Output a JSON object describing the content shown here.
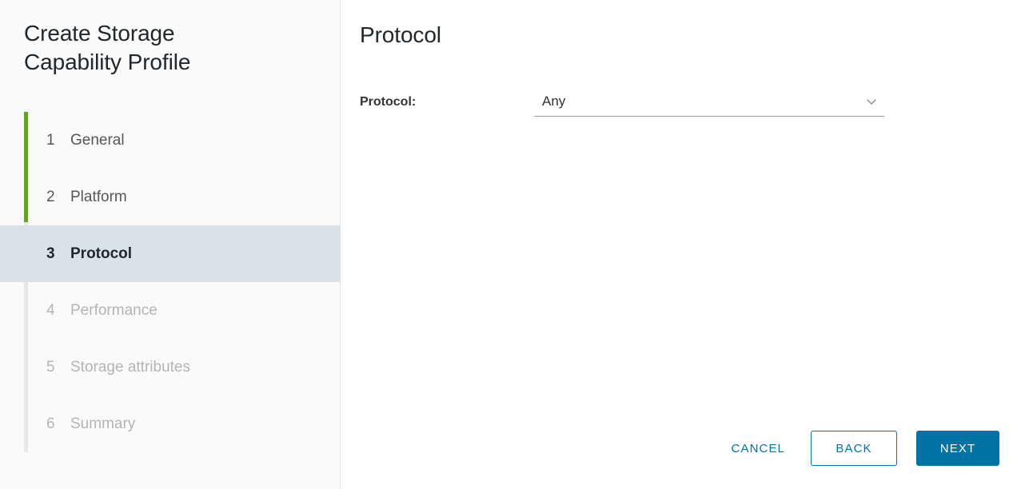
{
  "wizard": {
    "title": "Create Storage\nCapability Profile",
    "title_line1": "Create Storage",
    "title_line2": "Capability Profile",
    "progress_percent": 32,
    "accent_green": "#62a420",
    "accent_blue": "#0072a3",
    "active_step_bg": "#d9e1e9"
  },
  "sidebar": {
    "steps": [
      {
        "number": "1",
        "label": "General",
        "state": "complete"
      },
      {
        "number": "2",
        "label": "Platform",
        "state": "complete"
      },
      {
        "number": "3",
        "label": "Protocol",
        "state": "active"
      },
      {
        "number": "4",
        "label": "Performance",
        "state": "disabled"
      },
      {
        "number": "5",
        "label": "Storage attributes",
        "state": "disabled"
      },
      {
        "number": "6",
        "label": "Summary",
        "state": "disabled"
      }
    ]
  },
  "main": {
    "heading": "Protocol",
    "fields": [
      {
        "label": "Protocol:",
        "value": "Any",
        "icon": "chevron-down-icon"
      }
    ]
  },
  "footer": {
    "cancel_label": "CANCEL",
    "back_label": "BACK",
    "next_label": "NEXT"
  }
}
